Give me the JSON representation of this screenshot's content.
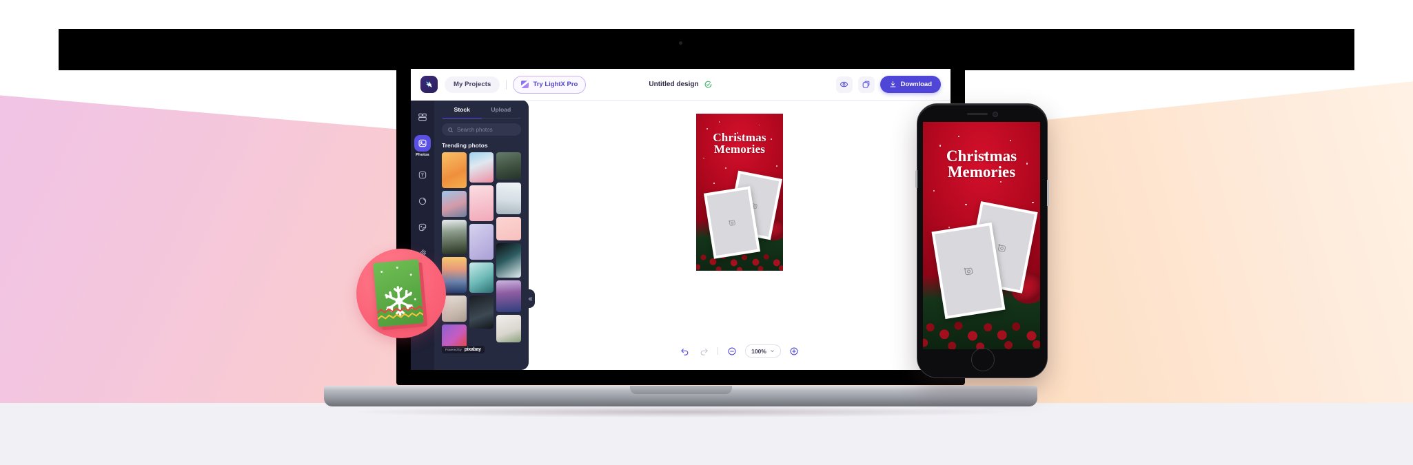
{
  "app": {
    "logo_icon": "lightx-logo-icon",
    "my_projects_label": "My Projects",
    "try_pro_label": "Try LightX Pro",
    "document_title": "Untitled design",
    "sync_icon": "sync-cloud-icon",
    "preview_icon": "eye-preview-icon",
    "resize_icon": "resize-layers-icon",
    "download_label": "Download",
    "download_icon": "download-icon",
    "accent_color": "#4f46d8",
    "panel_color": "#262a41",
    "rail_color": "#1f2136"
  },
  "rail": {
    "items": [
      {
        "name": "templates",
        "icon": "templates-grid-icon",
        "label": "",
        "active": false
      },
      {
        "name": "photos",
        "icon": "photos-image-icon",
        "label": "Photos",
        "active": true
      },
      {
        "name": "text",
        "icon": "text-t-icon",
        "label": "",
        "active": false
      },
      {
        "name": "shapes",
        "icon": "shape-circle-icon",
        "label": "",
        "active": false
      },
      {
        "name": "stickers",
        "icon": "sticker-icon",
        "label": "",
        "active": false
      },
      {
        "name": "effects",
        "icon": "effects-lines-icon",
        "label": "",
        "active": false
      }
    ]
  },
  "photos_panel": {
    "tabs": [
      {
        "label": "Stock",
        "active": true
      },
      {
        "label": "Upload",
        "active": false
      }
    ],
    "search": {
      "placeholder": "Search photos",
      "value": "",
      "icon": "search-icon"
    },
    "section_title": "Trending photos",
    "attribution": {
      "prefix": "Powered by",
      "brand": "pixabay"
    },
    "collapse_icon": "chevron-double-left-icon",
    "thumbnails": {
      "col1": [
        "#f4a44a",
        "#a9b8cf",
        "#2f3a2c",
        "#f0a95e",
        "#d8cfc6",
        "#8a5bd0"
      ],
      "col2": [
        "#9ecbe8",
        "#f6c4cc",
        "#c3bde0",
        "#7fc2c0",
        "#17181c"
      ],
      "col3": [
        "#4a5a4c",
        "#cfd9dd",
        "#fbd3d4",
        "#101417",
        "#6f4f9a",
        "#e7e4df"
      ]
    }
  },
  "canvas": {
    "design_title_line1": "Christmas",
    "design_title_line2": "Memories",
    "background_color": "#b00820",
    "placeholder_icon": "add-photo-icon",
    "placeholders": 2
  },
  "toolbar": {
    "undo_icon": "undo-icon",
    "redo_icon": "redo-icon",
    "zoom_out_icon": "zoom-out-icon",
    "zoom_in_icon": "zoom-in-icon",
    "zoom_level": "100%",
    "zoom_dropdown_icon": "chevron-down-icon"
  },
  "phone_preview": {
    "design_title_line1": "Christmas",
    "design_title_line2": "Memories",
    "placeholder_icon": "add-photo-icon"
  },
  "badge": {
    "name": "christmas-card-badge",
    "circle_color": "#fb6277",
    "card_color": "#5aa844",
    "icon": "snowflake-icon"
  }
}
